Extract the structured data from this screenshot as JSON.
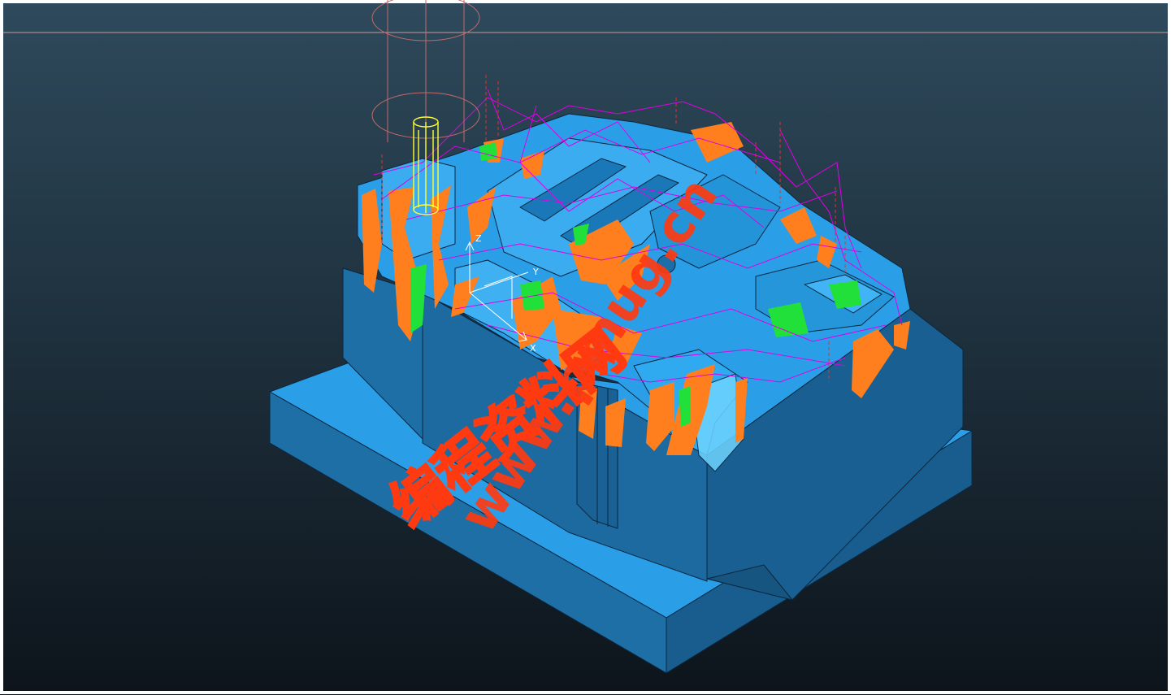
{
  "viewport": {
    "background_top": "#2e4a5c",
    "background_bottom": "#0d141b",
    "frame_color": "#ffffff"
  },
  "model": {
    "face_top_color": "#2a9fe8",
    "face_side_color": "#1e6fa6",
    "face_dark_color": "#185d8e",
    "edge_color": "#0a2740",
    "highlight_color": "#6fd4ff"
  },
  "toolpath": {
    "cut_color": "#ff7f1e",
    "green_color": "#22e03a",
    "link_color": "#e000e6",
    "retract_color": "#e03030"
  },
  "tool": {
    "holder_color": "#c46a6a",
    "cutter_color": "#ffff33"
  },
  "axes": {
    "x_label": "X",
    "y_label": "Y",
    "z_label": "Z",
    "color": "#ffffff"
  },
  "watermark": {
    "url_text": "www.pmug.cn",
    "cn_text": "编程资料网",
    "color": "#ff3a10"
  }
}
